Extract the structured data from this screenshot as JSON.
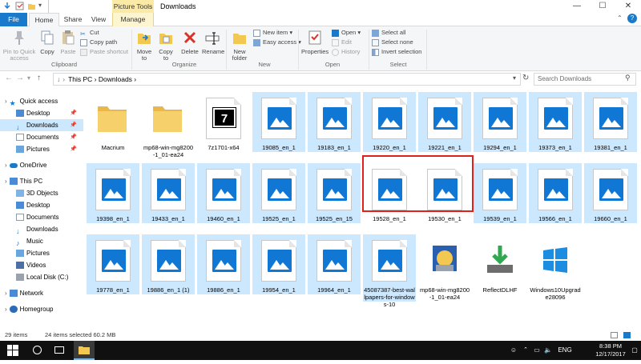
{
  "window": {
    "context_tab": "Picture Tools",
    "title": "Downloads",
    "controls": {
      "minimize": "—",
      "maximize": "☐",
      "close": "✕"
    }
  },
  "tabs": [
    "File",
    "Home",
    "Share",
    "View",
    "Manage"
  ],
  "ribbon": {
    "clipboard": {
      "pin_label": "Pin to Quick access",
      "copy": "Copy",
      "paste": "Paste",
      "cut": "Cut",
      "copy_path": "Copy path",
      "paste_shortcut": "Paste shortcut",
      "group": "Clipboard"
    },
    "organize": {
      "move_to": "Move to",
      "copy_to": "Copy to",
      "delete": "Delete",
      "rename": "Rename",
      "group": "Organize"
    },
    "new": {
      "new_folder": "New folder",
      "new_item": "New item ▾",
      "easy_access": "Easy access ▾",
      "group": "New"
    },
    "open": {
      "properties": "Properties",
      "open": "Open ▾",
      "edit": "Edit",
      "history": "History",
      "group": "Open"
    },
    "select": {
      "select_all": "Select all",
      "select_none": "Select none",
      "invert_selection": "Invert selection",
      "group": "Select"
    }
  },
  "address": {
    "path": "This PC  ›  Downloads  ›",
    "search_placeholder": "Search Downloads"
  },
  "nav": {
    "quick_access": "Quick access",
    "qa_items": [
      "Desktop",
      "Downloads",
      "Documents",
      "Pictures"
    ],
    "onedrive": "OneDrive",
    "this_pc": "This PC",
    "pc_items": [
      "3D Objects",
      "Desktop",
      "Documents",
      "Downloads",
      "Music",
      "Pictures",
      "Videos",
      "Local Disk (C:)"
    ],
    "network": "Network",
    "homegroup": "Homegroup"
  },
  "files": [
    {
      "name": "Macrium",
      "type": "folder",
      "selected": false
    },
    {
      "name": "mp68-win-mg8200-1_01-ea24",
      "type": "folder",
      "selected": false
    },
    {
      "name": "7z1701-x64",
      "type": "7z",
      "selected": false
    },
    {
      "name": "19085_en_1",
      "type": "image",
      "selected": true
    },
    {
      "name": "19183_en_1",
      "type": "image",
      "selected": true
    },
    {
      "name": "19220_en_1",
      "type": "image",
      "selected": true
    },
    {
      "name": "19221_en_1",
      "type": "image",
      "selected": true
    },
    {
      "name": "19294_en_1",
      "type": "image",
      "selected": true
    },
    {
      "name": "19373_en_1",
      "type": "image",
      "selected": true
    },
    {
      "name": "19381_en_1",
      "type": "image",
      "selected": true
    },
    {
      "name": "19398_en_1",
      "type": "image",
      "selected": true
    },
    {
      "name": "19433_en_1",
      "type": "image",
      "selected": true
    },
    {
      "name": "19460_en_1",
      "type": "image",
      "selected": true
    },
    {
      "name": "19525_en_1",
      "type": "image",
      "selected": true
    },
    {
      "name": "19525_en_15",
      "type": "image",
      "selected": true
    },
    {
      "name": "19528_en_1",
      "type": "image",
      "selected": false
    },
    {
      "name": "19530_en_1",
      "type": "image",
      "selected": false
    },
    {
      "name": "19539_en_1",
      "type": "image",
      "selected": true
    },
    {
      "name": "19566_en_1",
      "type": "image",
      "selected": true
    },
    {
      "name": "19660_en_1",
      "type": "image",
      "selected": true
    },
    {
      "name": "19778_en_1",
      "type": "image",
      "selected": true
    },
    {
      "name": "19886_en_1 (1)",
      "type": "image",
      "selected": true
    },
    {
      "name": "19886_en_1",
      "type": "image",
      "selected": true
    },
    {
      "name": "19954_en_1",
      "type": "image",
      "selected": true
    },
    {
      "name": "19964_en_1",
      "type": "image",
      "selected": true
    },
    {
      "name": "45087387-best-wallpapers-for-windows-10",
      "type": "image",
      "selected": true
    },
    {
      "name": "mp68-win-mg8200-1_01-ea24",
      "type": "installer",
      "selected": false
    },
    {
      "name": "ReflectDLHF",
      "type": "download",
      "selected": false
    },
    {
      "name": "Windows10Upgrade28096",
      "type": "windows",
      "selected": false
    }
  ],
  "status": {
    "items": "29 items",
    "selected": "24 items selected  60.2 MB"
  },
  "taskbar": {
    "lang": "ENG",
    "time": "8:38 PM",
    "date": "12/17/2017"
  }
}
